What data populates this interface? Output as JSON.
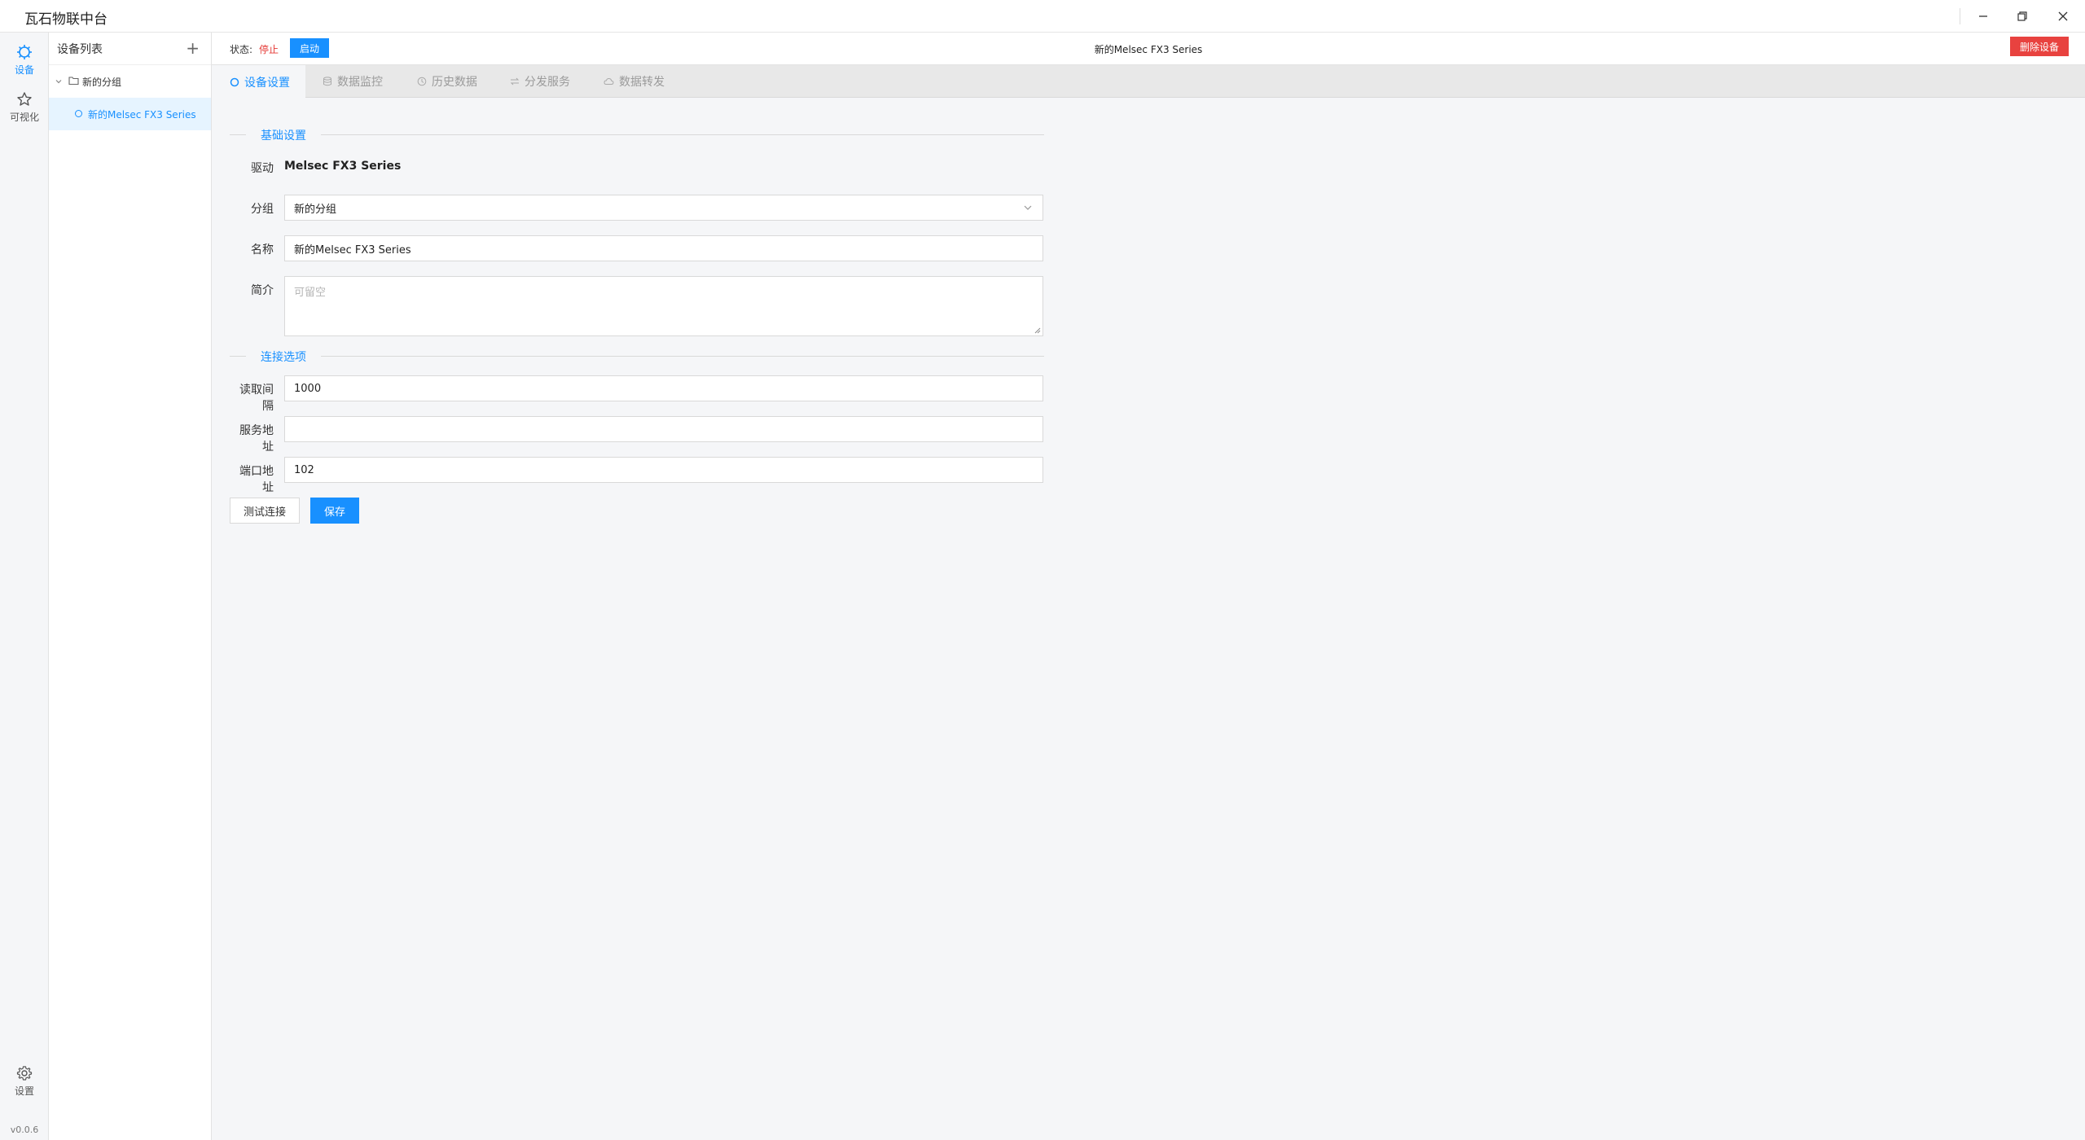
{
  "window": {
    "title": "瓦石物联中台",
    "controls": [
      "minimize",
      "restore",
      "close"
    ]
  },
  "activity_bar": {
    "items": [
      {
        "label": "设备",
        "icon": "chip-icon",
        "active": true
      },
      {
        "label": "可视化",
        "icon": "star-icon",
        "active": false
      },
      {
        "label": "设置",
        "icon": "gear-icon",
        "active": false
      }
    ],
    "version": "v0.0.6"
  },
  "device_panel": {
    "title": "设备列表",
    "add_label": "+",
    "group": {
      "label": "新的分组"
    },
    "device": {
      "label": "新的Melsec FX3 Series"
    }
  },
  "header": {
    "status_label": "状态:",
    "status_value": "停止",
    "start_label": "启动",
    "title": "新的Melsec FX3 Series",
    "delete_label": "删除设备"
  },
  "tabs": [
    {
      "label": "设备设置",
      "icon": "circle-icon",
      "active": true
    },
    {
      "label": "数据监控",
      "icon": "database-icon",
      "active": false
    },
    {
      "label": "历史数据",
      "icon": "clock-icon",
      "active": false
    },
    {
      "label": "分发服务",
      "icon": "exchange-icon",
      "active": false
    },
    {
      "label": "数据转发",
      "icon": "cloud-icon",
      "active": false
    }
  ],
  "form": {
    "basic_section": "基础设置",
    "driver_label": "驱动",
    "driver_value": "Melsec FX3 Series",
    "group_label": "分组",
    "group_value": "新的分组",
    "name_label": "名称",
    "name_value": "新的Melsec FX3 Series",
    "desc_label": "简介",
    "desc_placeholder": "可留空",
    "connection_section": "连接选项",
    "interval_label": "读取间隔",
    "interval_value": "1000",
    "address_label": "服务地址",
    "address_value": "",
    "port_label": "端口地址",
    "port_value": "102",
    "test_label": "测试连接",
    "save_label": "保存"
  },
  "colors": {
    "accent": "#1890ff",
    "danger": "#e8423f",
    "stopped": "#e53935"
  }
}
